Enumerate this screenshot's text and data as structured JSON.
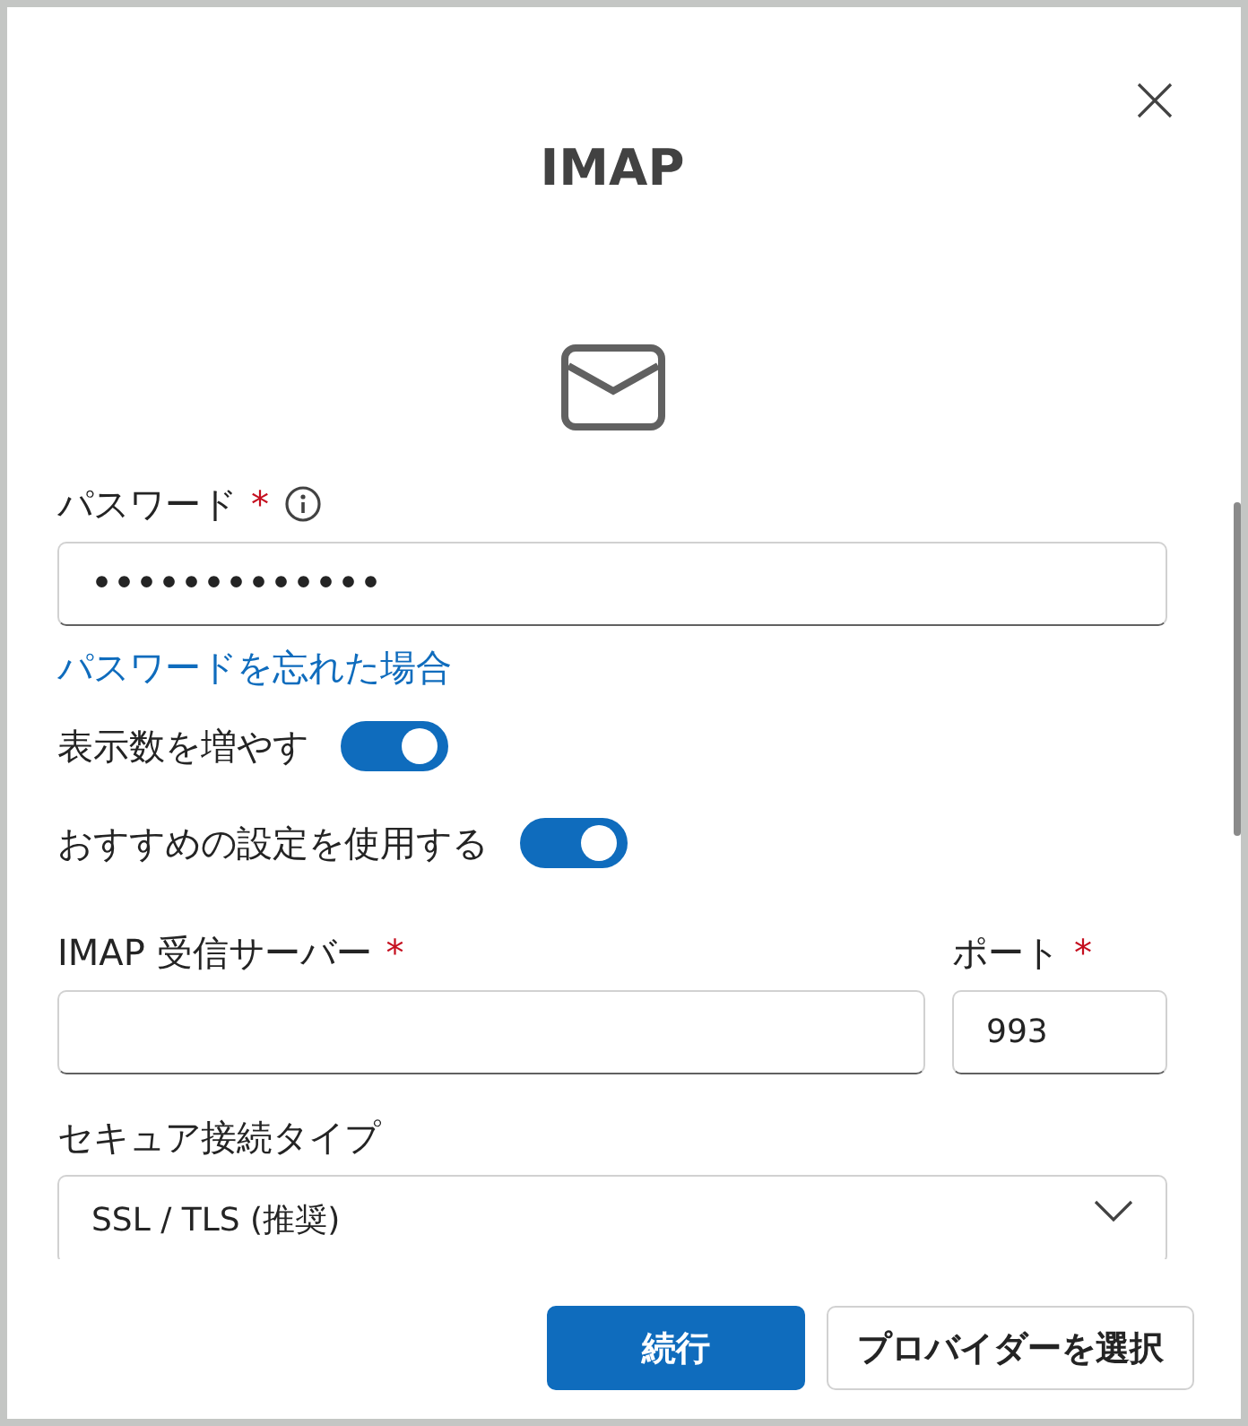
{
  "dialog": {
    "title": "IMAP",
    "password": {
      "label": "パスワード",
      "required_mark": "*",
      "value": "•••••••••••••"
    },
    "forgot_link": "パスワードを忘れた場合",
    "toggles": [
      {
        "label": "表示数を増やす",
        "on": true
      },
      {
        "label": "おすすめの設定を使用する",
        "on": true
      }
    ],
    "server": {
      "label": "IMAP 受信サーバー",
      "required_mark": "*"
    },
    "port": {
      "label": "ポート",
      "required_mark": "*",
      "value": "993"
    },
    "security": {
      "label": "セキュア接続タイプ",
      "value": "SSL / TLS (推奨)"
    },
    "buttons": [
      {
        "label": "続行",
        "kind": "primary"
      },
      {
        "label": "プロバイダーを選択",
        "kind": "secondary"
      }
    ]
  }
}
